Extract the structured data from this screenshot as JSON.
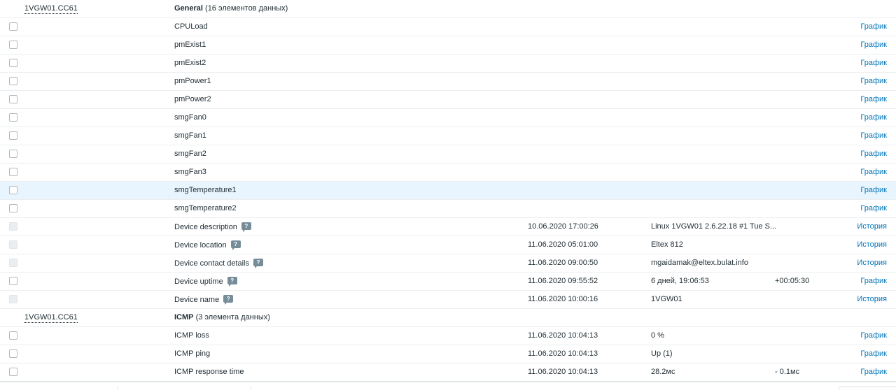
{
  "groups": [
    {
      "host": "1VGW01.CC61",
      "app_name": "General",
      "app_count": "(16 элементов данных)",
      "items": [
        {
          "name": "CPULoad",
          "help": false,
          "time": "",
          "value": "",
          "change": "",
          "action": "График",
          "disabled": false
        },
        {
          "name": "pmExist1",
          "help": false,
          "time": "",
          "value": "",
          "change": "",
          "action": "График",
          "disabled": false
        },
        {
          "name": "pmExist2",
          "help": false,
          "time": "",
          "value": "",
          "change": "",
          "action": "График",
          "disabled": false
        },
        {
          "name": "pmPower1",
          "help": false,
          "time": "",
          "value": "",
          "change": "",
          "action": "График",
          "disabled": false
        },
        {
          "name": "pmPower2",
          "help": false,
          "time": "",
          "value": "",
          "change": "",
          "action": "График",
          "disabled": false
        },
        {
          "name": "smgFan0",
          "help": false,
          "time": "",
          "value": "",
          "change": "",
          "action": "График",
          "disabled": false
        },
        {
          "name": "smgFan1",
          "help": false,
          "time": "",
          "value": "",
          "change": "",
          "action": "График",
          "disabled": false
        },
        {
          "name": "smgFan2",
          "help": false,
          "time": "",
          "value": "",
          "change": "",
          "action": "График",
          "disabled": false
        },
        {
          "name": "smgFan3",
          "help": false,
          "time": "",
          "value": "",
          "change": "",
          "action": "График",
          "disabled": false
        },
        {
          "name": "smgTemperature1",
          "help": false,
          "time": "",
          "value": "",
          "change": "",
          "action": "График",
          "disabled": false,
          "hover": true
        },
        {
          "name": "smgTemperature2",
          "help": false,
          "time": "",
          "value": "",
          "change": "",
          "action": "График",
          "disabled": false
        },
        {
          "name": "Device description",
          "help": true,
          "time": "10.06.2020 17:00:26",
          "value": "Linux 1VGW01 2.6.22.18 #1 Tue S...",
          "change": "",
          "action": "История",
          "disabled": true
        },
        {
          "name": "Device location",
          "help": true,
          "time": "11.06.2020 05:01:00",
          "value": "Eltex 812",
          "change": "",
          "action": "История",
          "disabled": true
        },
        {
          "name": "Device contact details",
          "help": true,
          "time": "11.06.2020 09:00:50",
          "value": "mgaidamak@eltex.bulat.info",
          "change": "",
          "action": "История",
          "disabled": true
        },
        {
          "name": "Device uptime",
          "help": true,
          "time": "11.06.2020 09:55:52",
          "value": "6 дней, 19:06:53",
          "change": "+00:05:30",
          "action": "График",
          "disabled": false
        },
        {
          "name": "Device name",
          "help": true,
          "time": "11.06.2020 10:00:16",
          "value": "1VGW01",
          "change": "",
          "action": "История",
          "disabled": true
        }
      ]
    },
    {
      "host": "1VGW01.CC61",
      "app_name": "ICMP",
      "app_count": "(3 элемента данных)",
      "items": [
        {
          "name": "ICMP loss",
          "help": false,
          "time": "11.06.2020 10:04:13",
          "value": "0 %",
          "change": "",
          "action": "График",
          "disabled": false
        },
        {
          "name": "ICMP ping",
          "help": false,
          "time": "11.06.2020 10:04:13",
          "value": "Up (1)",
          "change": "",
          "action": "График",
          "disabled": false
        },
        {
          "name": "ICMP response time",
          "help": false,
          "time": "11.06.2020 10:04:13",
          "value": "28.2мс",
          "change": "- 0.1мс",
          "action": "График",
          "disabled": false
        }
      ]
    }
  ],
  "colors": {
    "link": "#0275b8",
    "hover_row": "#e8f5ff",
    "row_border": "#ebeef0",
    "text": "#1f2c33"
  }
}
